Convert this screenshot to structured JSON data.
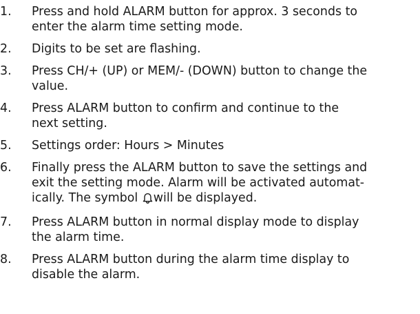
{
  "steps": [
    {
      "number": "1.",
      "lines": [
        "Press and hold ALARM button for approx. 3 seconds to",
        "enter the alarm time setting mode."
      ]
    },
    {
      "number": "2.",
      "lines": [
        "Digits to be set are flashing."
      ]
    },
    {
      "number": "3.",
      "lines": [
        "Press CH/+ (UP) or MEM/- (DOWN) button to change the",
        "value."
      ]
    },
    {
      "number": "4.",
      "lines": [
        "Press ALARM button to confirm and continue to the",
        "next setting."
      ]
    },
    {
      "number": "5.",
      "lines": [
        "Settings order: Hours > Minutes"
      ]
    },
    {
      "number": "6.",
      "lines": [
        "Finally press the ALARM button to save the settings and",
        "exit the setting mode. Alarm will be activated automat-",
        "ically. The symbol",
        "will be displayed."
      ],
      "icon": "bell-icon"
    },
    {
      "number": "7.",
      "lines": [
        "Press ALARM button in normal display mode to display",
        "the alarm time."
      ]
    },
    {
      "number": "8.",
      "lines": [
        "Press ALARM button during the alarm time display to",
        "disable the alarm."
      ]
    }
  ]
}
